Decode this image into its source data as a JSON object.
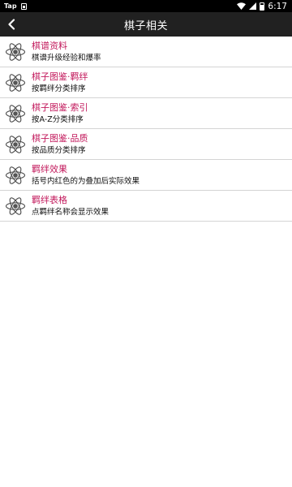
{
  "status_bar": {
    "notification_label": "Tap",
    "time": "6:17",
    "icons": [
      "notification-icon",
      "wifi-icon",
      "signal-icon",
      "battery-icon"
    ]
  },
  "app_bar": {
    "title": "棋子相关",
    "back_icon": "chevron-left-icon"
  },
  "colors": {
    "app_bar": "#212121",
    "item_title": "#c2185b",
    "divider": "#d4d4d4"
  },
  "list": {
    "items": [
      {
        "title": "棋谱资料",
        "subtitle": "棋谱升级经验和爆率",
        "icon": "atom-icon"
      },
      {
        "title": "棋子图鉴·羁绊",
        "subtitle": "按羁绊分类排序",
        "icon": "atom-icon"
      },
      {
        "title": "棋子图鉴·索引",
        "subtitle": "按A-Z分类排序",
        "icon": "atom-icon"
      },
      {
        "title": "棋子图鉴·品质",
        "subtitle": "按品质分类排序",
        "icon": "atom-icon"
      },
      {
        "title": "羁绊效果",
        "subtitle": "括号内红色的为叠加后实际效果",
        "icon": "atom-icon"
      },
      {
        "title": "羁绊表格",
        "subtitle": "点羁绊名称会显示效果",
        "icon": "atom-icon"
      }
    ]
  }
}
